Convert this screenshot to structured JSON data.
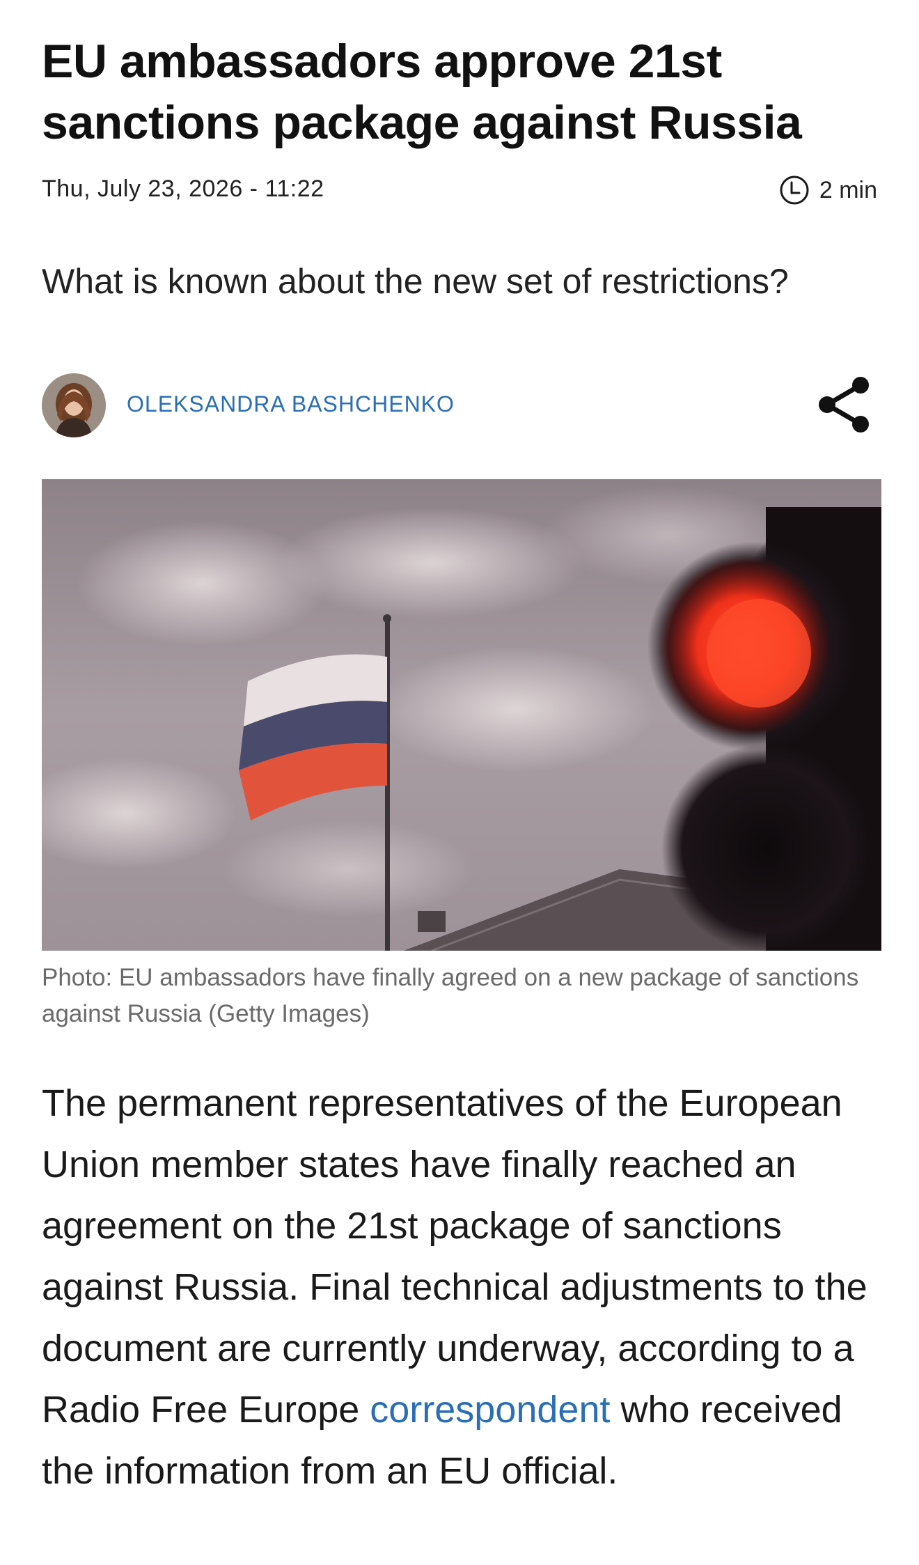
{
  "article": {
    "headline": "EU ambassadors approve 21st sanctions package against Russia",
    "date": "Thu, July 23, 2026 - 11:22",
    "read_time": "2 min",
    "subtitle": "What is known about the new set of restrictions?",
    "author": "OLEKSANDRA BASHCHENKO",
    "caption": "Photo: EU ambassadors have finally agreed on a new package of sanctions against Russia (Getty Images)",
    "body_before_link": "The permanent representatives of the European Union member states have finally reached an agreement on the 21st package of sanctions against Russia. Final technical adjustments to the document are currently underway, according to a Radio Free Europe ",
    "body_link": "correspondent",
    "body_after_link": " who received the information from an EU official."
  },
  "icons": {
    "clock": "clock-icon",
    "share": "share-icon"
  },
  "colors": {
    "accent_link": "#2a6fb6",
    "text": "#1a1a1a",
    "caption": "#6a6a6a"
  }
}
